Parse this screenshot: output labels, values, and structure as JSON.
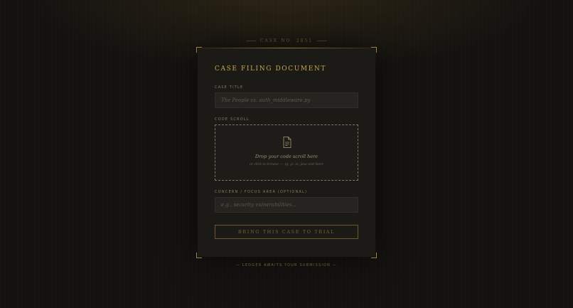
{
  "header": {
    "case_number": "CASE NO. 2851"
  },
  "form": {
    "title": "CASE FILING DOCUMENT",
    "case_title": {
      "label": "CASE TITLE",
      "placeholder": "The People vs. auth_middleware.py",
      "value": ""
    },
    "code_scroll": {
      "label": "CODE SCROLL",
      "icon": "document-icon",
      "drop_text": "Drop your code scroll here",
      "hint_text": "or click to browse — .py .js .ts .java and more"
    },
    "concern": {
      "label": "CONCERN / FOCUS AREA (OPTIONAL)",
      "placeholder": "e.g., security vulnerabilities...",
      "value": ""
    },
    "submit_label": "BRING THIS CASE TO TRIAL"
  },
  "footer": {
    "text": "— LEDGER AWAITS YOUR SUBMISSION —"
  },
  "colors": {
    "background": "#141210",
    "panel": "#1c1a17",
    "accent_gold": "#c5a948",
    "field_bg": "#262420"
  }
}
